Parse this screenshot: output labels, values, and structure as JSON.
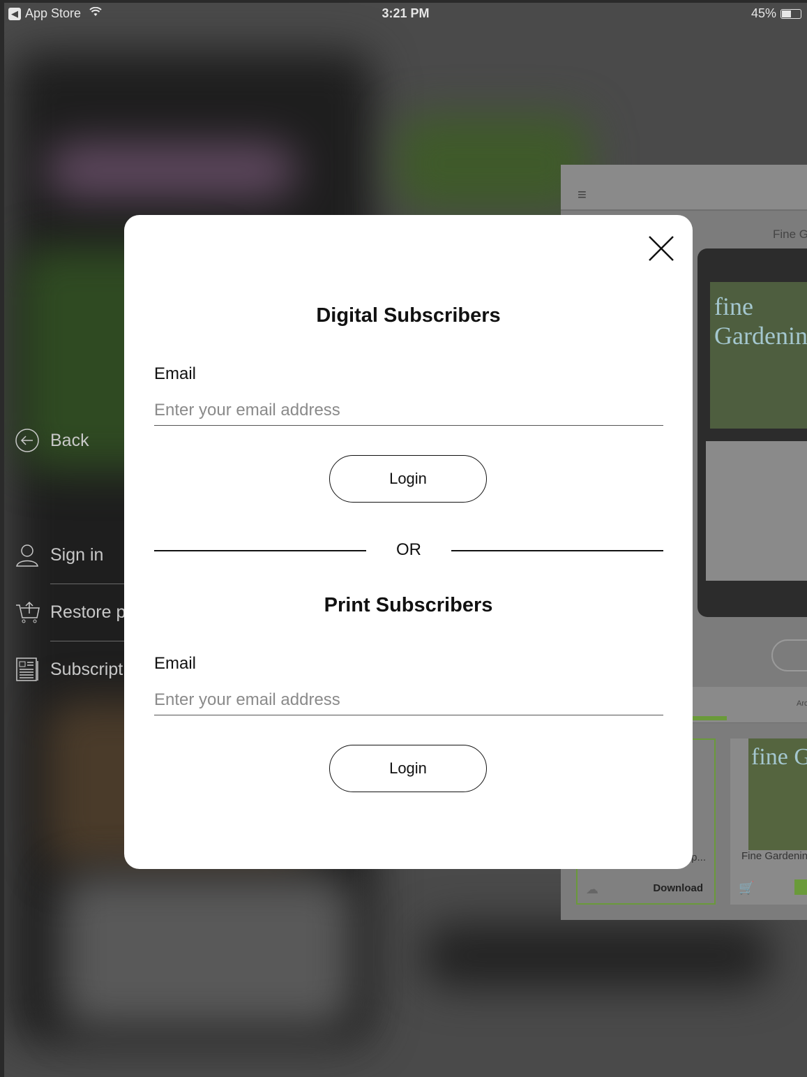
{
  "status_bar": {
    "back_app": "App Store",
    "time": "3:21 PM",
    "battery": "45%"
  },
  "side_menu": {
    "items": [
      {
        "label": "Back",
        "icon": "back-arrow-circle-icon"
      },
      {
        "label": "Sign in",
        "icon": "user-icon"
      },
      {
        "label": "Restore p",
        "icon": "cart-restore-icon"
      },
      {
        "label": "Subscript",
        "icon": "newspaper-icon"
      }
    ]
  },
  "background_app": {
    "title": "Fine G",
    "cover_title": "fine Gardening",
    "tab_label": "Arc",
    "card1": {
      "title": "p...",
      "action": "Download"
    },
    "card2": {
      "title": "Fine Gardenin"
    }
  },
  "modal": {
    "digital": {
      "title": "Digital Subscribers",
      "email_label": "Email",
      "email_placeholder": "Enter your email address",
      "login_label": "Login"
    },
    "separator": "OR",
    "print": {
      "title": "Print Subscribers",
      "email_label": "Email",
      "email_placeholder": "Enter your email address",
      "login_label": "Login"
    }
  },
  "colors": {
    "accent_green": "#6a9a3a",
    "overlay": "#4a4a4a",
    "modal_bg": "#ffffff"
  }
}
